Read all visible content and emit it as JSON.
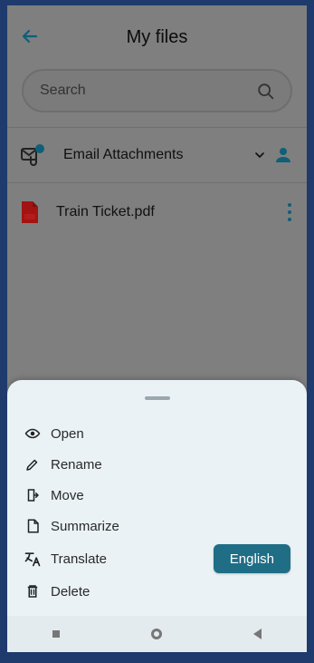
{
  "header": {
    "title": "My files"
  },
  "search": {
    "placeholder": "Search"
  },
  "folder": {
    "label": "Email Attachments"
  },
  "file": {
    "name": "Train Ticket.pdf"
  },
  "sheet": {
    "items": [
      {
        "label": "Open",
        "icon": "eye-icon"
      },
      {
        "label": "Rename",
        "icon": "pencil-icon"
      },
      {
        "label": "Move",
        "icon": "move-icon"
      },
      {
        "label": "Summarize",
        "icon": "document-icon"
      },
      {
        "label": "Translate",
        "icon": "translate-icon"
      },
      {
        "label": "Delete",
        "icon": "trash-icon"
      }
    ],
    "language_button": "English"
  },
  "colors": {
    "frame": "#1f3b6d",
    "dimmed_screen": "#7f7f80",
    "sheet": "#eaf2f5",
    "accent": "#1f6e86"
  }
}
